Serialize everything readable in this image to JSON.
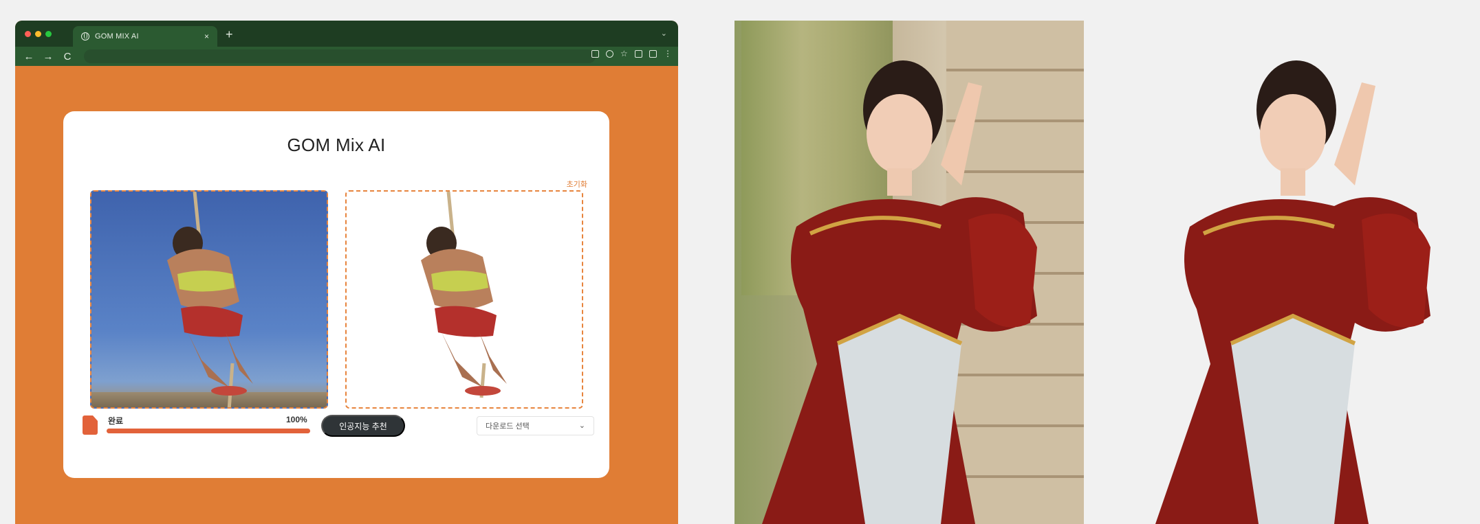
{
  "browser": {
    "tab_title": "GOM MIX AI",
    "tab_close": "×",
    "new_tab": "+",
    "tab_list": "⌄",
    "nav": {
      "back": "←",
      "forward": "→",
      "reload": "C"
    },
    "traffic_colors": [
      "#ff5f57",
      "#febc2e",
      "#28c840"
    ]
  },
  "app": {
    "title": "GOM Mix AI",
    "reset_label": "초기화",
    "status": {
      "label": "완료",
      "percent_text": "100%",
      "progress": 1.0
    },
    "recommend_button": "인공지능 추천",
    "download_select": {
      "selected": "다운로드 선택"
    }
  },
  "colors": {
    "page_bg": "#e07d35",
    "accent": "#e2623a",
    "titlebar": "#1e3d22",
    "toolbar": "#2b5a31"
  }
}
